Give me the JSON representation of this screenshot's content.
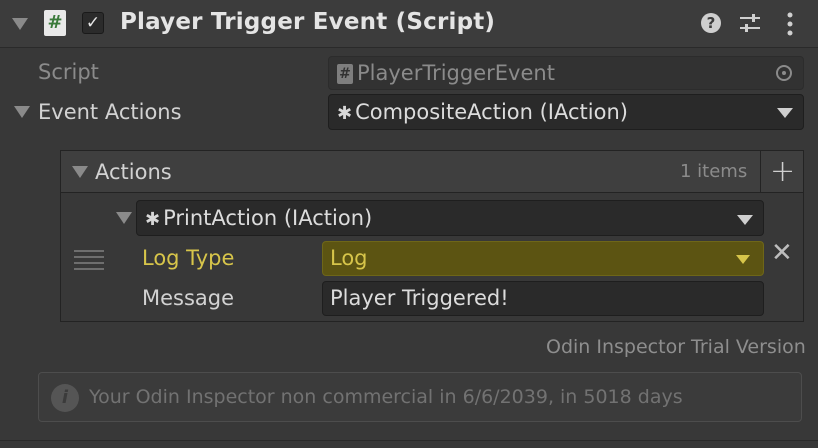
{
  "header": {
    "script_icon": "#",
    "checkbox_mark": "✓",
    "title": "Player Trigger Event (Script)",
    "help_icon": "?",
    "settings_icon": "sliders-icon",
    "menu_icon": "kebab-icon"
  },
  "script_row": {
    "label": "Script",
    "hash_icon": "#",
    "value": "PlayerTriggerEvent"
  },
  "event_actions": {
    "label": "Event Actions",
    "puzzle_icon": "✱",
    "value": "CompositeAction (IAction)"
  },
  "actions_list": {
    "label": "Actions",
    "count": "1 items",
    "add_label": "+",
    "item": {
      "puzzle_icon": "✱",
      "type_value": "PrintAction (IAction)",
      "log_type_label": "Log Type",
      "log_type_value": "Log",
      "message_label": "Message",
      "message_value": "Player Triggered!",
      "remove_label": "✕"
    }
  },
  "trial_notice": "Odin Inspector Trial Version",
  "info": {
    "icon": "i",
    "text": "Your Odin Inspector non commercial in 6/6/2039, in 5018 days"
  },
  "colors": {
    "background": "#383838",
    "highlight_yellow": "#d7c54a",
    "log_field": "#5c5412"
  }
}
